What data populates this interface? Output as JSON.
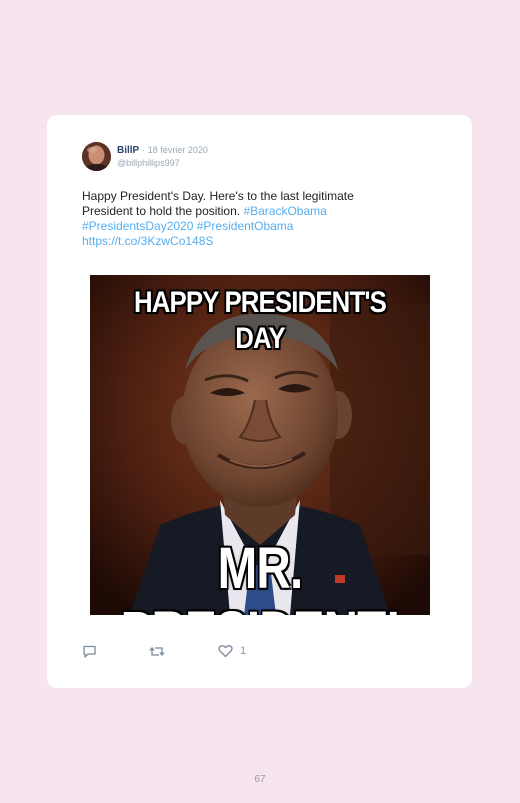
{
  "tweet": {
    "display_name": "BillP",
    "separator": "·",
    "date": "18 février 2020",
    "handle": "@billphillips997",
    "text_line1": "Happy President's Day. Here's to the last legitimate",
    "text_line2_plain": "President to hold the position. ",
    "hashtag1": "#BarackObama",
    "hashtag2": "#PresidentsDay2020",
    "hashtag3": "#PresidentObama",
    "link": "https://t.co/3KzwCo148S",
    "media": {
      "top_text": "HAPPY PRESIDENT'S DAY",
      "bottom_text": "MR. PRESIDENT!"
    },
    "actions": {
      "reply_icon": "reply-icon",
      "retweet_icon": "retweet-icon",
      "like_icon": "heart-icon",
      "like_count": "1"
    }
  },
  "colors": {
    "page_background": "#f6e4ee",
    "card_background": "#ffffff",
    "link": "#55aef0",
    "display_name": "#2c4470",
    "muted": "#9aa8b8"
  },
  "page": {
    "number": "67"
  }
}
